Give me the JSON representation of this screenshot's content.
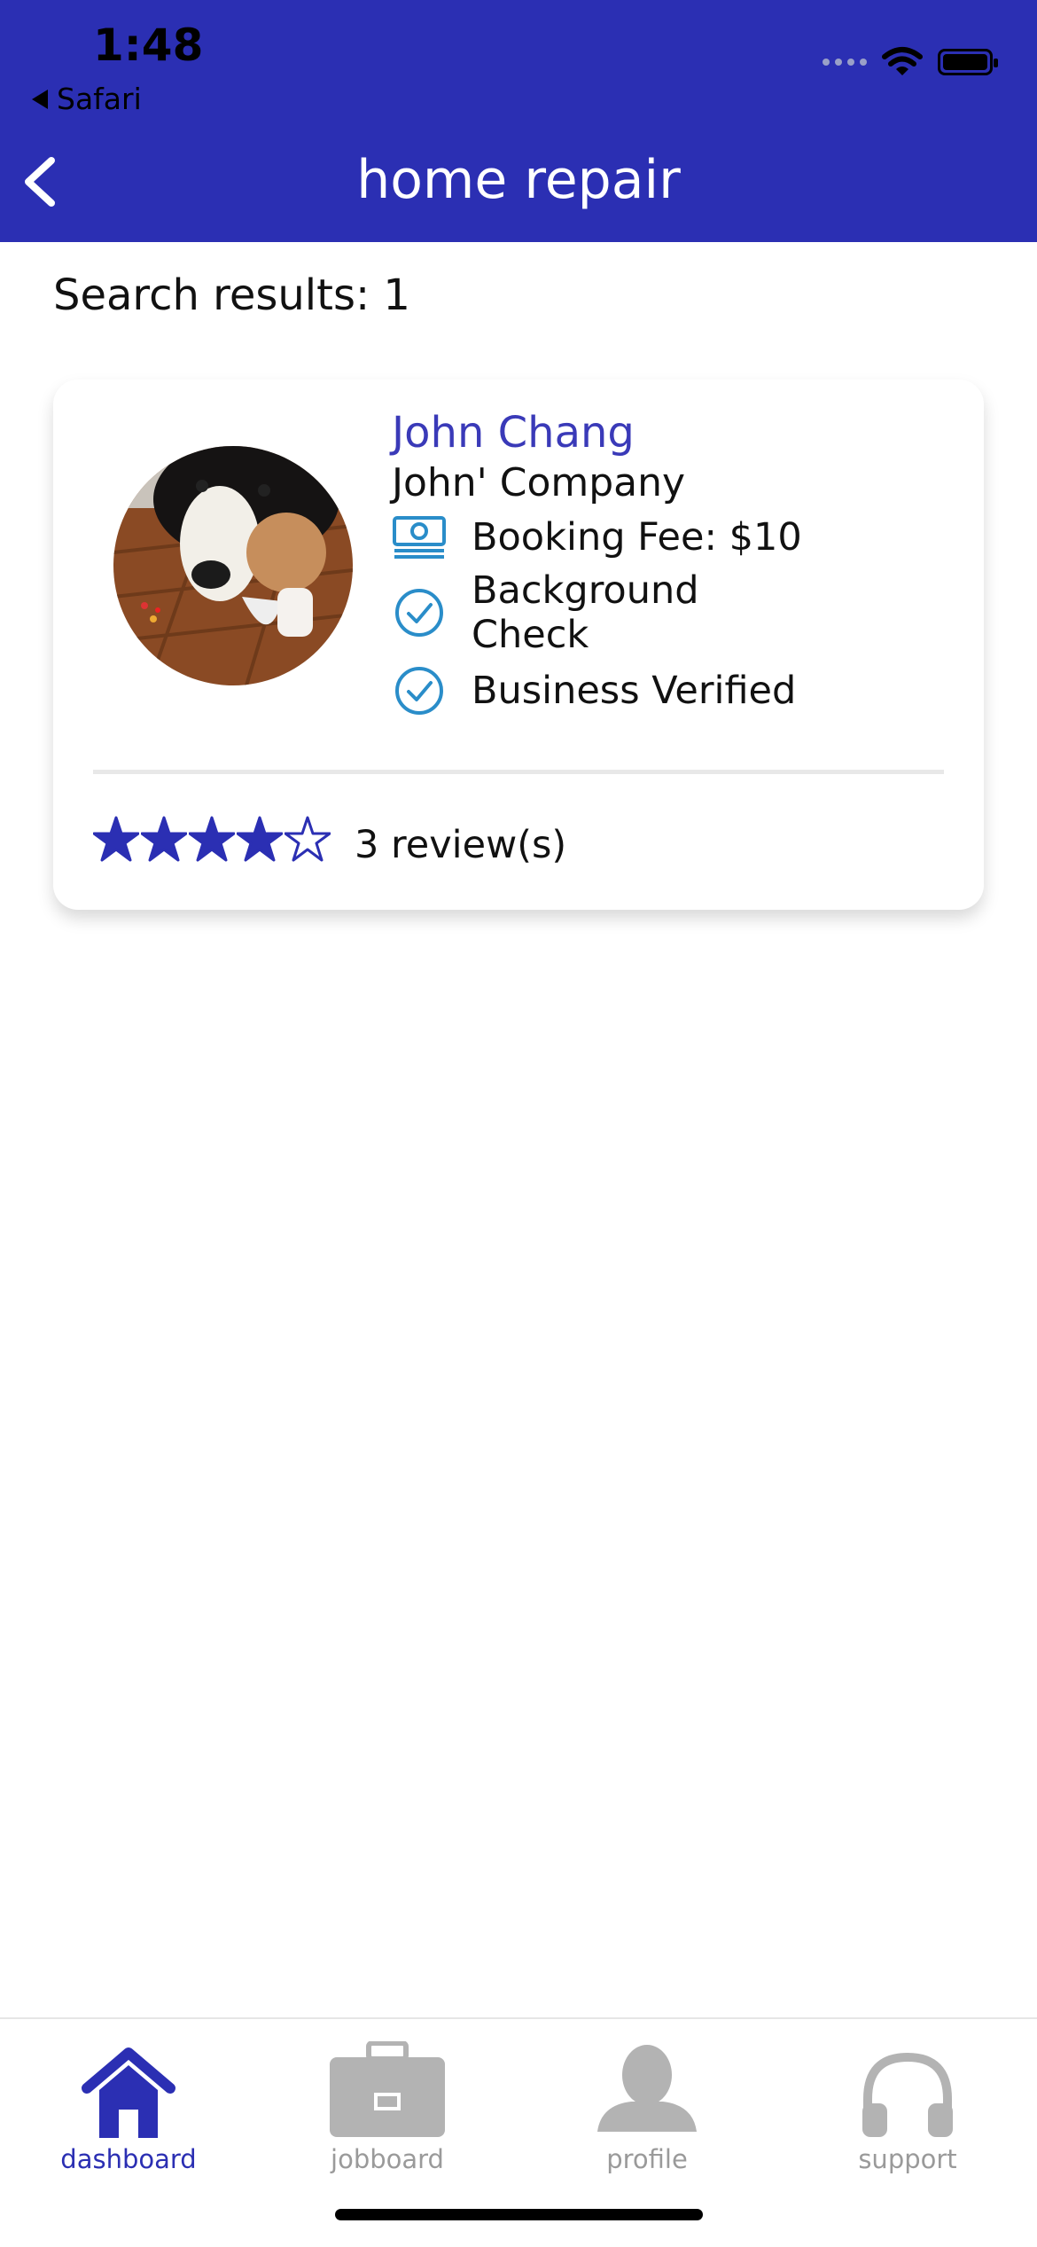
{
  "status_bar": {
    "time": "1:48",
    "back_app": "Safari"
  },
  "header": {
    "title": "home repair"
  },
  "search": {
    "results_label": "Search results: 1"
  },
  "result": {
    "name": "John Chang",
    "company": "John' Company",
    "booking_fee": "Booking Fee: $10",
    "background_check": "Background Check",
    "business_verified": "Business Verified",
    "rating": 4,
    "rating_max": 5,
    "reviews": "3 review(s)"
  },
  "tabs": [
    {
      "label": "dashboard",
      "icon": "home-icon",
      "active": true
    },
    {
      "label": "jobboard",
      "icon": "briefcase-icon",
      "active": false
    },
    {
      "label": "profile",
      "icon": "person-icon",
      "active": false
    },
    {
      "label": "support",
      "icon": "headphones-icon",
      "active": false
    }
  ],
  "colors": {
    "primary": "#2b2fb3",
    "icon_blue": "#2a8dc9",
    "inactive": "#b3b3b3"
  }
}
